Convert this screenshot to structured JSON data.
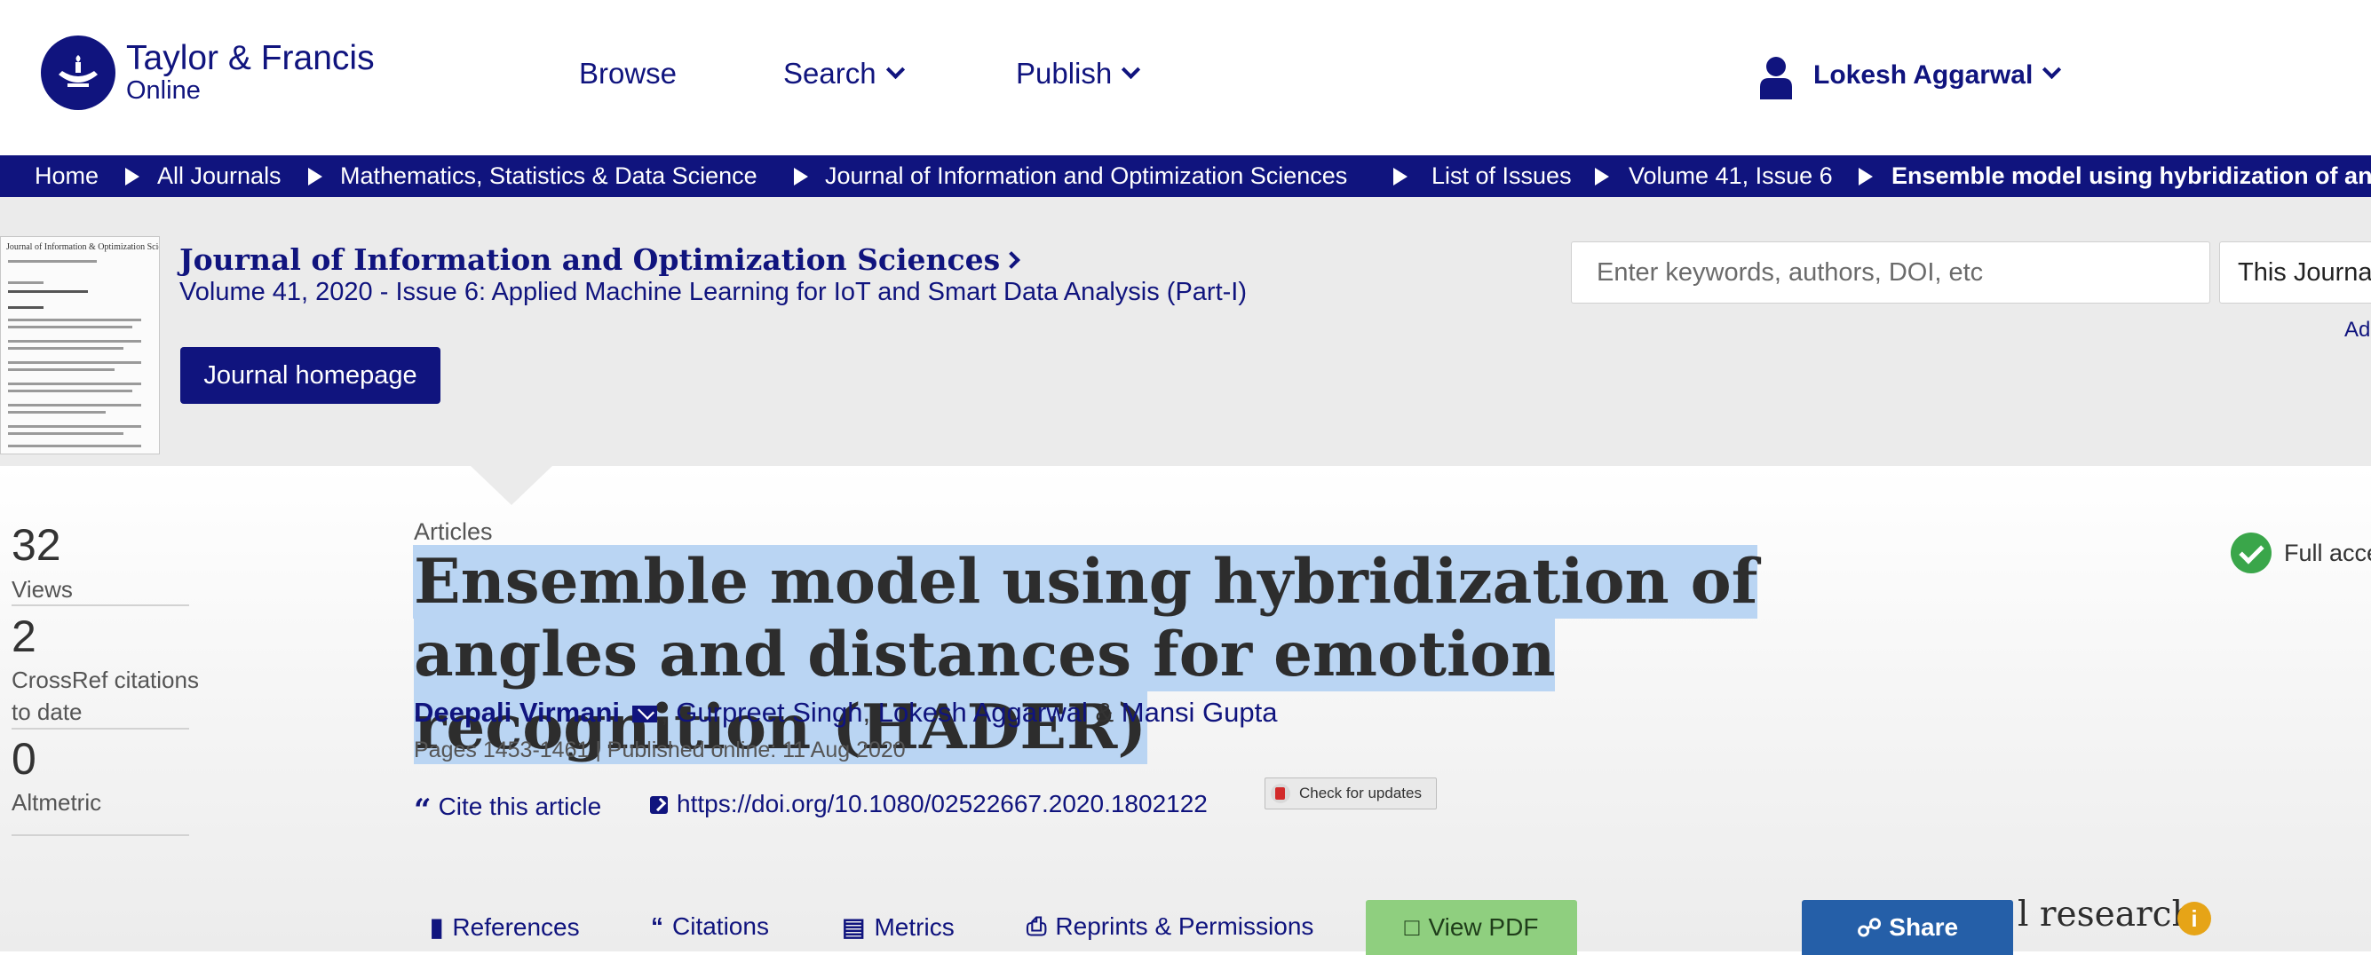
{
  "header": {
    "logo_line1": "Taylor & Francis",
    "logo_line2": "Online",
    "nav": [
      {
        "label": "Browse"
      },
      {
        "label": "Search"
      },
      {
        "label": "Publish"
      }
    ],
    "user_name": "Lokesh Aggarwal"
  },
  "breadcrumb": [
    "Home",
    "All Journals",
    "Mathematics, Statistics & Data Science",
    "Journal of Information and Optimization Sciences",
    "List of Issues",
    "Volume 41, Issue 6",
    "Ensemble model using hybridization of an ..."
  ],
  "journal": {
    "title": "Journal of Information and Optimization Sciences",
    "volume_prefix": "Volume 41, 2020 - ",
    "issue_link": "Issue 6: Applied Machine Learning for IoT and Smart Data Analysis (Part-I)",
    "homepage_button": "Journal homepage",
    "cover_title": "Journal of Information & Optimization Sciences"
  },
  "search": {
    "placeholder": "Enter keywords, authors, DOI, etc",
    "scope": "This Journal",
    "advanced": "Ad"
  },
  "metrics": [
    {
      "value": "32",
      "label": "Views"
    },
    {
      "value": "2",
      "label": "CrossRef citations to date"
    },
    {
      "value": "0",
      "label": "Altmetric"
    }
  ],
  "article": {
    "type": "Articles",
    "title": "Ensemble model using hybridization of angles and distances for emotion recognition (HADER)",
    "authors": {
      "first": "Deepali Virmani",
      "comma1": ", ",
      "second": "Gurpreet Singh",
      "comma2": ", ",
      "third": "Lokesh Aggarwal",
      "amp": " & ",
      "fourth": "Mansi Gupta"
    },
    "pages_line": "Pages 1453-1461 | Published online: 11 Aug 2020",
    "cite": "Cite this article",
    "doi": "https://doi.org/10.1080/02522667.2020.1802122",
    "check_updates": "Check for updates",
    "access": "Full acce"
  },
  "tabs": {
    "references": "References",
    "citations": "Citations",
    "metrics": "Metrics",
    "reprints": "Reprints & Permissions",
    "view_pdf": "View PDF"
  },
  "share": "Share",
  "side_heading_fragment": "l research",
  "colors": {
    "brand": "#10147e",
    "selection": "#bad5f3",
    "pdf": "#8fcf7f",
    "share": "#255fa8",
    "access": "#3aa64a",
    "info": "#e6a417"
  }
}
